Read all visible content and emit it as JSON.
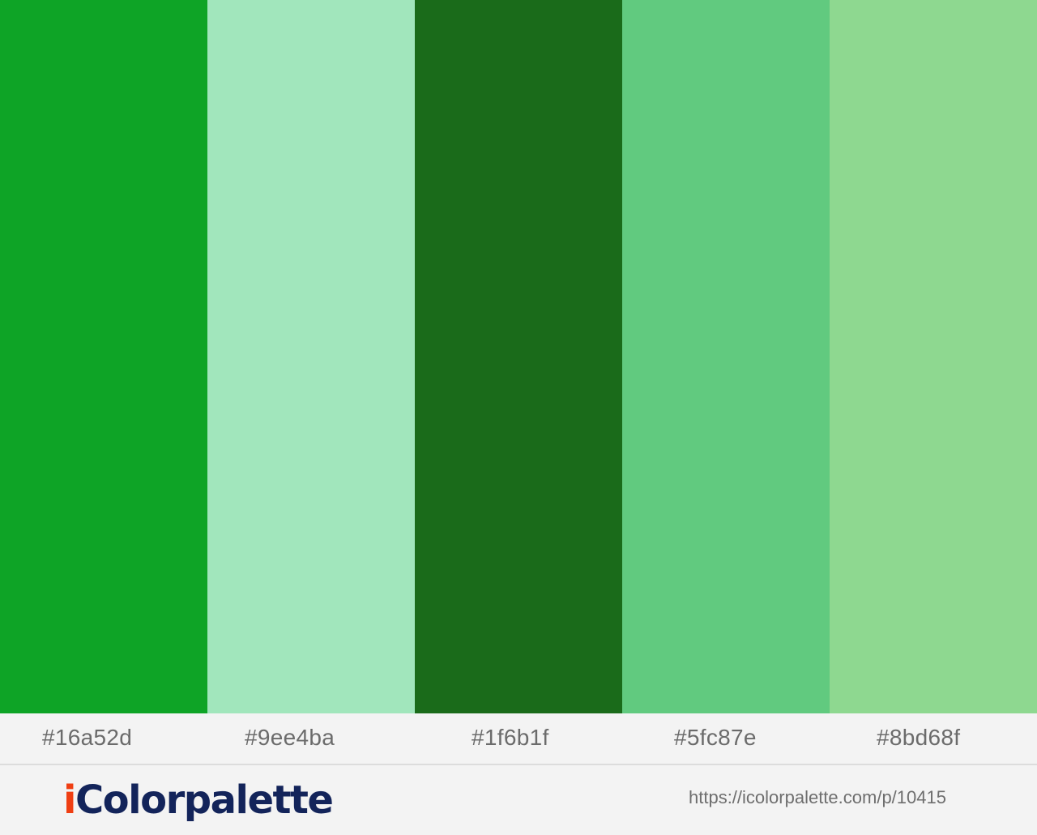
{
  "palette": [
    {
      "hex": "#16a52d",
      "label": "#16a52d"
    },
    {
      "hex": "#9ee4ba",
      "label": "#9ee4ba"
    },
    {
      "hex": "#1f6b1f",
      "label": "#1f6b1f"
    },
    {
      "hex": "#5fc87e",
      "label": "#5fc87e"
    },
    {
      "hex": "#8bd68f",
      "label": "#8bd68f"
    }
  ],
  "footer": {
    "logo_i": "i",
    "logo_rest": "Colorpalette",
    "url": "https://icolorpalette.com/p/10415"
  },
  "colors": {
    "logo_accent": "#ef3e12",
    "logo_text": "#13245a",
    "code_text": "#6b6b6b",
    "background": "#f3f3f3"
  }
}
